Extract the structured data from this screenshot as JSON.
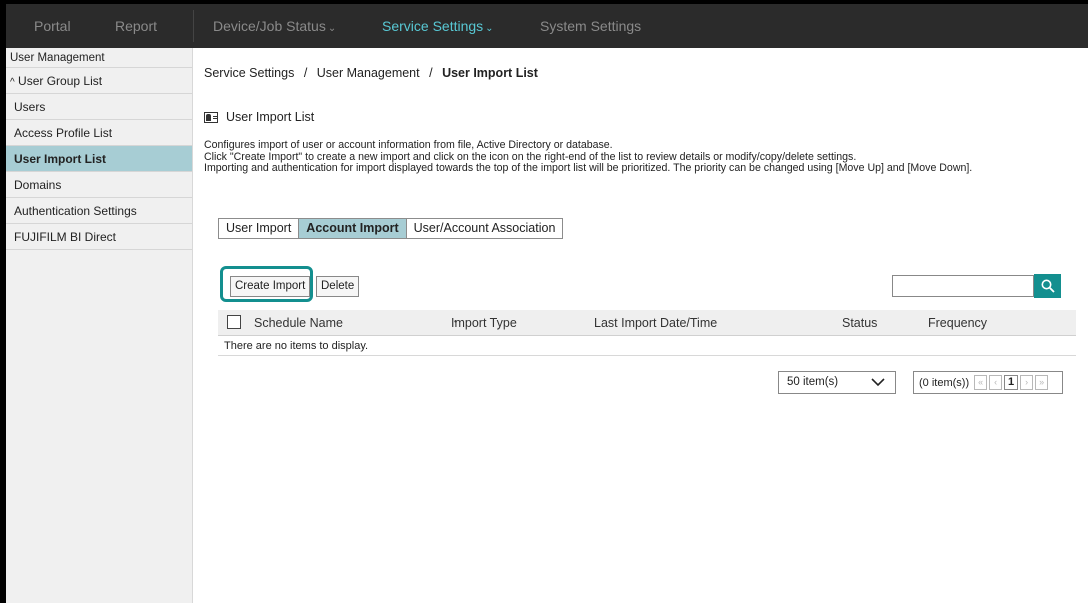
{
  "nav": {
    "items": [
      {
        "label": "Portal",
        "active": false
      },
      {
        "label": "Report",
        "active": false
      },
      {
        "label": "Device/Job Status",
        "active": false,
        "dropdown": true
      },
      {
        "label": "Service Settings",
        "active": true,
        "dropdown": true
      },
      {
        "label": "System Settings",
        "active": false
      }
    ],
    "caret": "⌄"
  },
  "sidebar": {
    "header": "User Management",
    "group": "User Group List",
    "group_icon": "caret-up-icon",
    "items": [
      {
        "label": "Users"
      },
      {
        "label": "Access Profile List"
      },
      {
        "label": "User Import List",
        "selected": true
      },
      {
        "label": "Domains"
      },
      {
        "label": "Authentication Settings"
      },
      {
        "label": "FUJIFILM BI Direct"
      }
    ]
  },
  "breadcrumb": {
    "parts": [
      "Service Settings",
      "User Management"
    ],
    "current": "User Import List",
    "separator": "/"
  },
  "page": {
    "title": "User Import List",
    "description": [
      "Configures import of user or account information from file, Active Directory or database.",
      "Click \"Create Import\" to create a new import and click on the icon on the right-end of the list to review details or modify/copy/delete settings.",
      "Importing and authentication for import displayed towards the top of the import list will be prioritized. The priority can be changed using [Move Up] and [Move Down]."
    ]
  },
  "tabs": [
    {
      "label": "User Import",
      "active": false
    },
    {
      "label": "Account Import",
      "active": true
    },
    {
      "label": "User/Account Association",
      "active": false
    }
  ],
  "toolbar": {
    "create_label": "Create Import",
    "delete_label": "Delete",
    "search_value": ""
  },
  "table": {
    "columns": [
      "Schedule Name",
      "Import Type",
      "Last Import Date/Time",
      "Status",
      "Frequency"
    ],
    "sort_indicator": "•",
    "empty_message": "There are no items to display."
  },
  "pagination": {
    "page_size": "50 item(s)",
    "count": "(0 item(s))",
    "current_page": "1"
  },
  "colors": {
    "accent": "#58c8d4",
    "selected_bg": "#a7cdd4",
    "highlight": "#138f8f",
    "nav_bg": "#2b2b2b"
  }
}
